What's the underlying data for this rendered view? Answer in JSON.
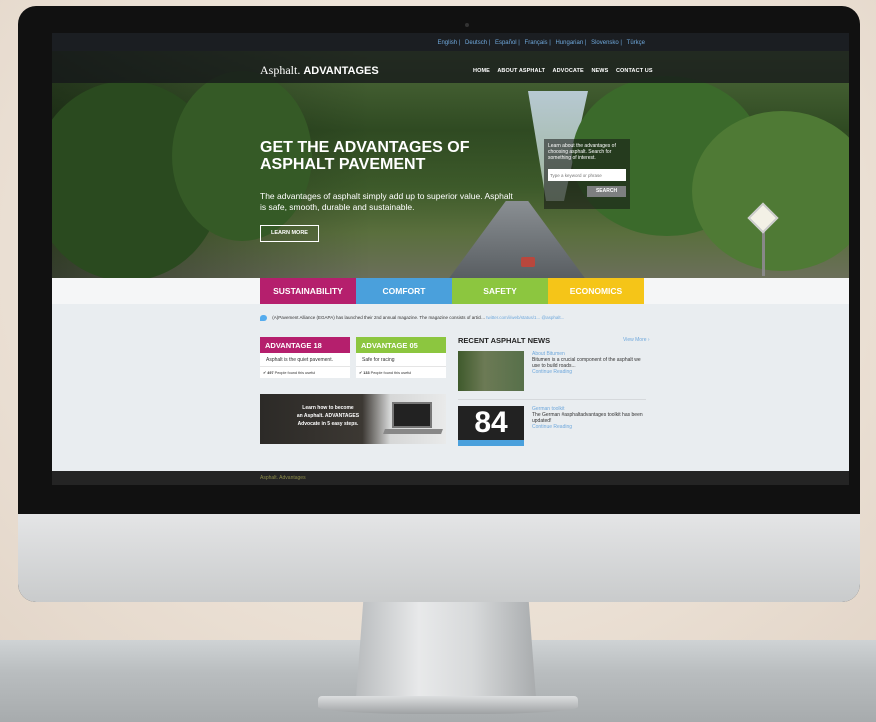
{
  "lang_bar": [
    "English",
    "Deutsch",
    "Español",
    "Français",
    "Hungarian",
    "Slovensko",
    "Türkçe"
  ],
  "header": {
    "logo_light": "Asphalt.",
    "logo_bold": "ADVANTAGES"
  },
  "nav": [
    "HOME",
    "ABOUT ASPHALT",
    "ADVOCATE",
    "NEWS",
    "CONTACT US"
  ],
  "hero": {
    "title": "GET THE ADVANTAGES OF ASPHALT PAVEMENT",
    "subtitle": "The advantages of asphalt simply add up to superior value. Asphalt is safe, smooth, durable and sustainable.",
    "button": "LEARN MORE"
  },
  "search": {
    "text": "Learn about the advantages of choosing asphalt. Search for something of interest.",
    "placeholder": "Type a keyword or phrase",
    "button": "SEARCH"
  },
  "tabs": [
    {
      "label": "SUSTAINABILITY",
      "color": "#b51f6d"
    },
    {
      "label": "COMFORT",
      "color": "#4aa0dc"
    },
    {
      "label": "SAFETY",
      "color": "#8cc63f"
    },
    {
      "label": "ECONOMICS",
      "color": "#f5c518"
    }
  ],
  "tweet": {
    "text": "(A)Pavement Alliance (EGAPA) has launched their 2nd annual magazine. The magazine consists of articl...",
    "link": "twitter.com/i/web/status/1...",
    "handle": "@asphalt..."
  },
  "advantages": [
    {
      "title": "ADVANTAGE 18",
      "body": "Asphalt is the quiet pavement.",
      "count": "497",
      "count_label": "People found this useful",
      "color": "#b51f6d"
    },
    {
      "title": "ADVANTAGE 05",
      "body": "Safe for racing",
      "count": "133",
      "count_label": "People found this useful",
      "color": "#8cc63f"
    }
  ],
  "advocate": {
    "line1": "Learn how to become",
    "line2": "an Asphalt. ADVANTAGES",
    "line3": "Advocate in 5 easy steps."
  },
  "news": {
    "title": "RECENT ASPHALT NEWS",
    "view_more": "View More",
    "items": [
      {
        "heading": "About Bitumen",
        "body": "Bitumen is a crucial component of the asphalt we use to build roads...",
        "link": "Continue Reading"
      },
      {
        "heading": "German toolkit",
        "body": "The German #asphaltadvantages toolkit has been updated!",
        "link": "Continue Reading",
        "thumb_text": "84"
      }
    ]
  },
  "footer": {
    "text": "Asphalt. Advantages"
  }
}
